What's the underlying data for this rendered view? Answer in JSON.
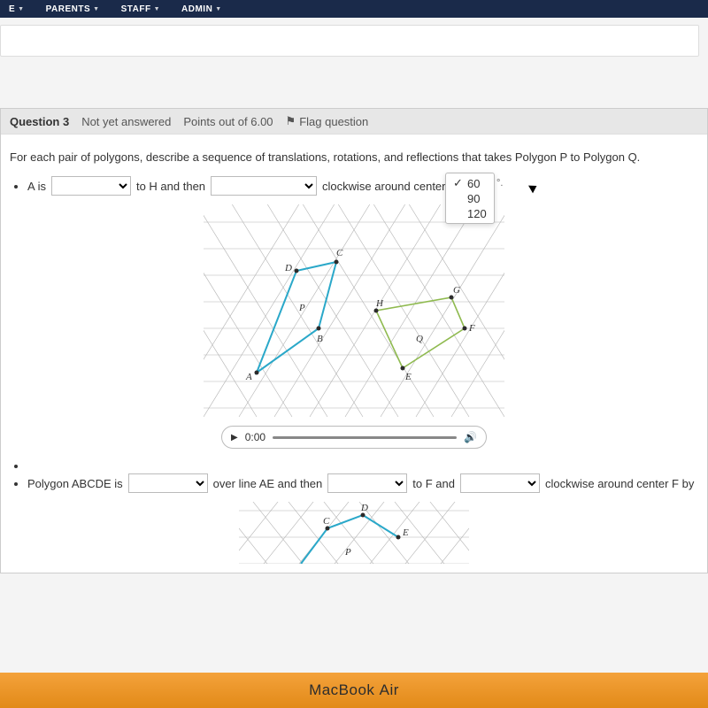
{
  "topnav": {
    "items": [
      "E",
      "PARENTS",
      "STAFF",
      "ADMIN"
    ]
  },
  "question": {
    "number": "Question 3",
    "status": "Not yet answered",
    "points": "Points out of 6.00",
    "flag": "Flag question",
    "prompt": "For each pair of polygons, describe a sequence of translations, rotations, and reflections that takes Polygon P to Polygon Q.",
    "partA": {
      "lead": "A is",
      "to_h": "to H and then",
      "tail": "clockwise around center H b",
      "degree": "°.",
      "options": [
        "60",
        "90",
        "120"
      ],
      "selected": "60"
    },
    "figure1_labels": {
      "A": "A",
      "B": "B",
      "C": "C",
      "D": "D",
      "P": "P",
      "H": "H",
      "G": "G",
      "F": "F",
      "Q": "Q",
      "E": "E"
    },
    "audio": {
      "time": "0:00"
    },
    "partB": {
      "lead": "Polygon ABCDE is",
      "over_line": "over line AE and then",
      "to_f": "to F and",
      "tail": "clockwise around center F by"
    },
    "figure2_labels": {
      "C": "C",
      "D": "D",
      "E": "E",
      "P": "P"
    }
  },
  "bezel": {
    "brand": "MacBook ",
    "air": "Air"
  }
}
